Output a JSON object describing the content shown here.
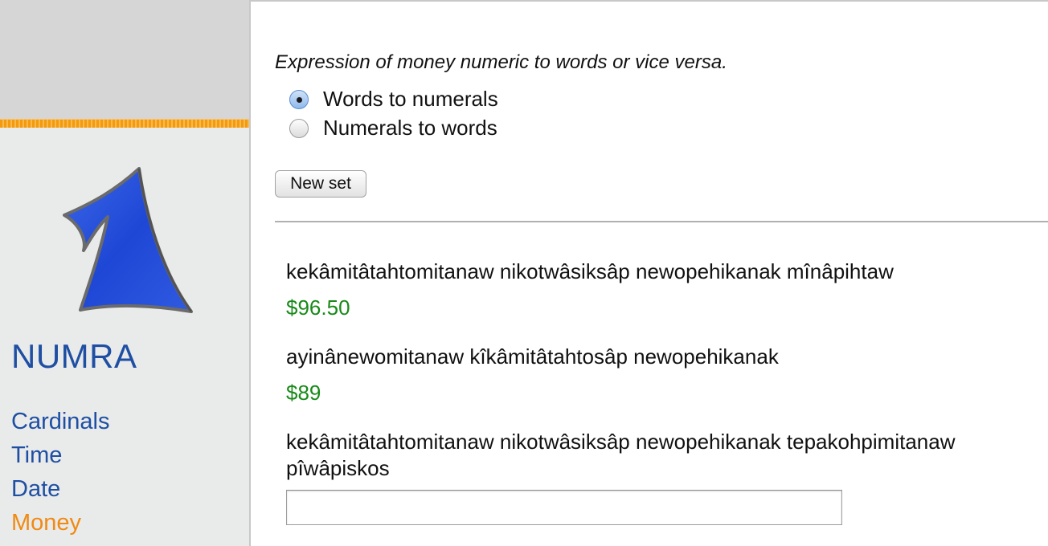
{
  "sidebar": {
    "brand": "NUMRA",
    "nav": [
      {
        "label": "Cardinals",
        "active": false
      },
      {
        "label": "Time",
        "active": false
      },
      {
        "label": "Date",
        "active": false
      },
      {
        "label": "Money",
        "active": true
      }
    ],
    "logo_icon": "blue-one-numeral-icon",
    "colors": {
      "link": "#1e4fa3",
      "active_link": "#f08a14",
      "accent_line": "#f29a10"
    }
  },
  "main": {
    "instruction": "Expression of money numeric to words or vice versa.",
    "modes": [
      {
        "label": "Words to numerals",
        "checked": true
      },
      {
        "label": "Numerals to words",
        "checked": false
      }
    ],
    "new_set_label": "New set",
    "exercises": [
      {
        "question": "kekâmitâtahtomitanaw nikotwâsiksâp newopehikanak mînâpihtaw",
        "answer": "$96.50"
      },
      {
        "question": "ayinânewomitanaw kîkâmitâtahtosâp newopehikanak",
        "answer": "$89"
      },
      {
        "question": "kekâmitâtahtomitanaw nikotwâsiksâp newopehikanak tepakohpimitanaw pîwâpiskos",
        "input_value": ""
      }
    ],
    "answer_color": "#178a17"
  }
}
